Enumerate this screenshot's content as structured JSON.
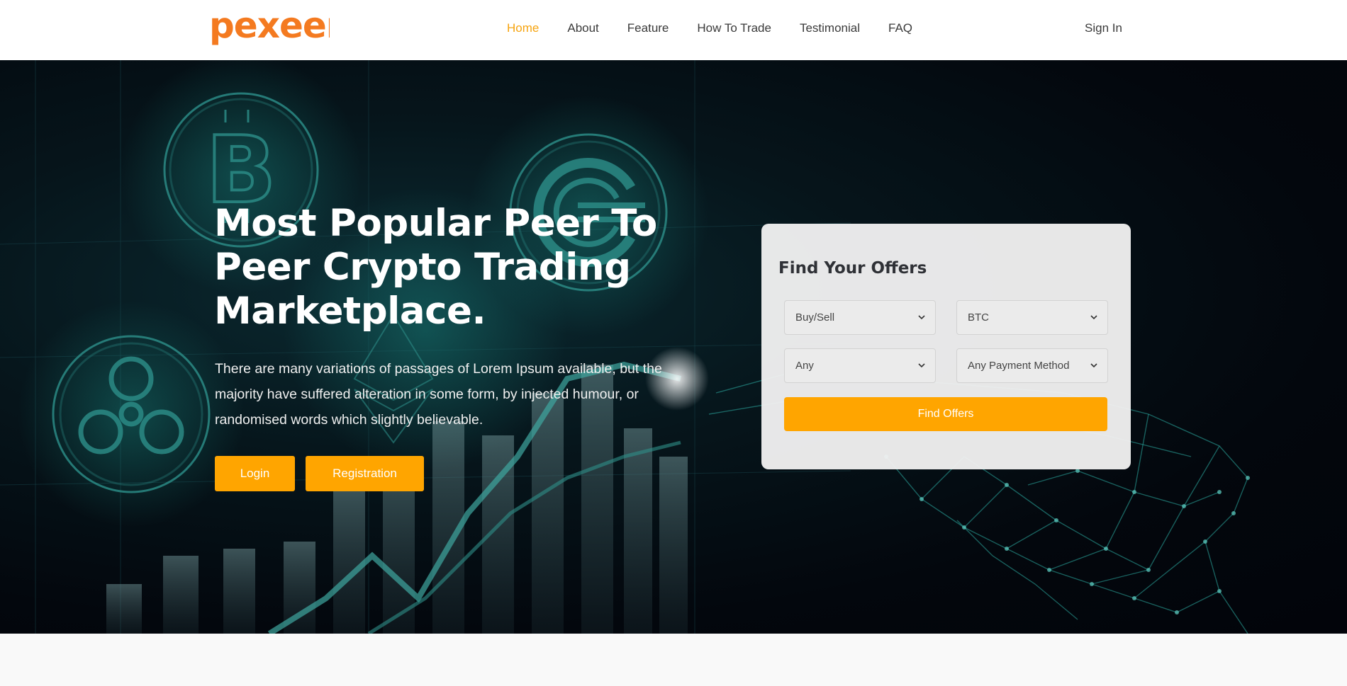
{
  "brand": {
    "name": "pexeer",
    "color": "#f47a20"
  },
  "nav": {
    "links": [
      {
        "label": "Home",
        "active": true
      },
      {
        "label": "About",
        "active": false
      },
      {
        "label": "Feature",
        "active": false
      },
      {
        "label": "How To Trade",
        "active": false
      },
      {
        "label": "Testimonial",
        "active": false
      },
      {
        "label": "FAQ",
        "active": false
      }
    ],
    "sign_in": "Sign In"
  },
  "hero": {
    "title": "Most Popular Peer To Peer Crypto Trading Marketplace.",
    "description": "There are many variations of passages of Lorem Ipsum available, but the majority have suffered alteration in some form, by injected humour, or randomised words which slightly believable.",
    "login_label": "Login",
    "registration_label": "Registration"
  },
  "offers": {
    "title": "Find Your Offers",
    "type_select": "Buy/Sell",
    "coin_select": "BTC",
    "country_select": "Any",
    "payment_select": "Any Payment Method",
    "find_label": "Find Offers"
  },
  "colors": {
    "accent": "#ffa500",
    "active_nav": "#f6a410",
    "hero_bg": "#03070d"
  },
  "icons": [
    "bitcoin-icon",
    "coin-c-icon",
    "ripple-icon",
    "ethereum-icon",
    "chevron-down-icon"
  ]
}
